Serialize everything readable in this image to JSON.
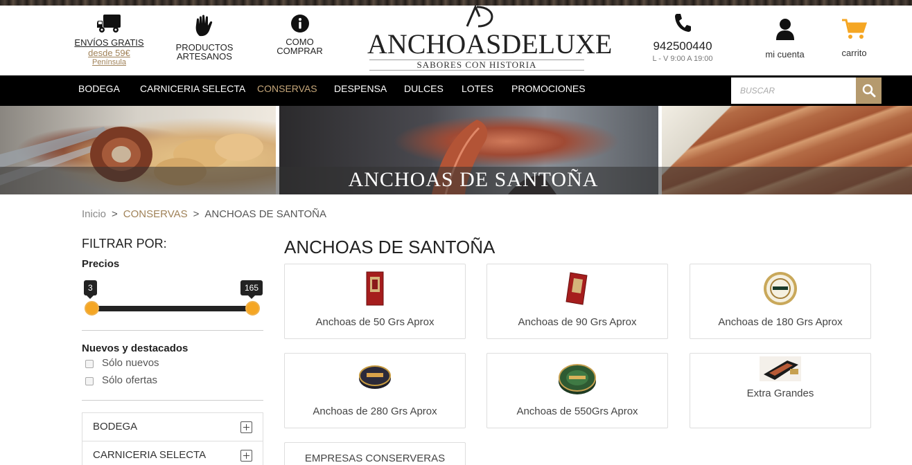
{
  "header": {
    "envios": {
      "line1": "ENVÍOS GRATIS",
      "line2": "desde 59€",
      "line3": "Península",
      "icon": "truck-icon"
    },
    "artesanos": {
      "line1": "PRODUCTOS",
      "line2": "ARTESANOS",
      "icon": "hand-icon"
    },
    "como": {
      "line1": "COMO",
      "line2": "COMPRAR",
      "icon": "info-icon"
    },
    "logo": {
      "brand": "ANCHOASDELUXE",
      "tagline": "SABORES CON HISTORIA",
      "monogram": "AD"
    },
    "phone": {
      "number": "942500440",
      "hours": "L - V 9:00 A 19:00",
      "icon": "phone-icon"
    },
    "account": {
      "label": "mi cuenta",
      "icon": "user-icon"
    },
    "cart": {
      "label": "carrito",
      "icon": "cart-icon"
    }
  },
  "nav": {
    "items": [
      "BODEGA",
      "CARNICERIA SELECTA",
      "CONSERVAS",
      "DESPENSA",
      "DULCES",
      "LOTES",
      "PROMOCIONES"
    ],
    "active": "CONSERVAS",
    "search_placeholder": "BUSCAR"
  },
  "banner": {
    "title": "ANCHOAS DE SANTOÑA"
  },
  "breadcrumb": {
    "home": "Inicio",
    "sep": ">",
    "category": "CONSERVAS",
    "current": "ANCHOAS DE SANTOÑA"
  },
  "filters": {
    "title": "FILTRAR POR:",
    "price": {
      "label": "Precios",
      "min": "3",
      "max": "165"
    },
    "nuevos": {
      "label": "Nuevos y destacados",
      "options": [
        "Sólo nuevos",
        "Sólo ofertas"
      ]
    },
    "categories": [
      "BODEGA",
      "CARNICERIA SELECTA"
    ]
  },
  "page_title": "ANCHOAS DE SANTOÑA",
  "products": [
    {
      "name": "Anchoas de 50 Grs Aprox"
    },
    {
      "name": "Anchoas de 90 Grs Aprox"
    },
    {
      "name": "Anchoas de 180 Grs Aprox"
    },
    {
      "name": "Anchoas de 280 Grs Aprox"
    },
    {
      "name": "Anchoas de 550Grs Aprox"
    },
    {
      "name": "Extra Grandes"
    },
    {
      "name": "EMPRESAS CONSERVERAS"
    }
  ],
  "colors": {
    "accent": "#c6a77a",
    "gold_button": "#b59a6e",
    "slider_handle": "#f5a623",
    "cart": "#f5a623"
  }
}
